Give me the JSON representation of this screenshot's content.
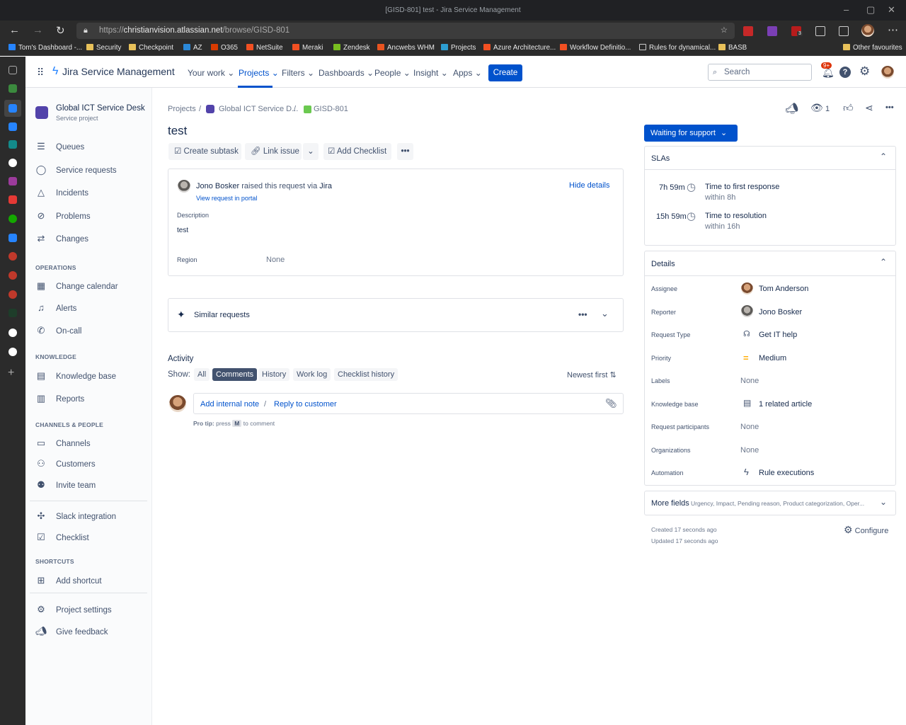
{
  "browser": {
    "window_title": "[GISD-801] test - Jira Service Management",
    "url_prefix": "https://",
    "url_host": "christianvision.atlassian.net",
    "url_path": "/browse/GISD-801",
    "bookmarks": [
      "Tom's Dashboard -...",
      "Security",
      "Checkpoint",
      "AZ",
      "O365",
      "NetSuite",
      "Meraki",
      "Zendesk",
      "Ancwebs WHM",
      "Projects",
      "Azure Architecture...",
      "Workflow Definitio...",
      "Rules for dynamical...",
      "BASB",
      "Other favourites"
    ],
    "notification_badge": "3"
  },
  "topnav": {
    "product": "Jira Service Management",
    "items": [
      "Your work",
      "Projects",
      "Filters",
      "Dashboards",
      "People",
      "Insight",
      "Apps"
    ],
    "create": "Create",
    "search_placeholder": "Search",
    "notifications": "9+"
  },
  "sidebar": {
    "project_name": "Global ICT Service Desk",
    "project_type": "Service project",
    "main": [
      "Queues",
      "Service requests",
      "Incidents",
      "Problems",
      "Changes"
    ],
    "operations_header": "OPERATIONS",
    "operations": [
      "Change calendar",
      "Alerts",
      "On-call"
    ],
    "knowledge_header": "KNOWLEDGE",
    "knowledge": [
      "Knowledge base",
      "Reports"
    ],
    "channels_header": "CHANNELS & PEOPLE",
    "channels": [
      "Channels",
      "Customers",
      "Invite team"
    ],
    "apps": [
      "Slack integration",
      "Checklist"
    ],
    "shortcuts_header": "SHORTCUTS",
    "shortcuts": [
      "Add shortcut"
    ],
    "footer": [
      "Project settings",
      "Give feedback"
    ]
  },
  "issue": {
    "breadcrumb": [
      "Projects",
      "Global ICT Service D...",
      "GISD-801"
    ],
    "title": "test",
    "toolbar": {
      "create_subtask": "Create subtask",
      "link_issue": "Link issue",
      "add_checklist": "Add Checklist"
    },
    "request": {
      "raiser": "Jono Bosker",
      "raised_text": "raised this request via",
      "via": "Jira",
      "view_portal": "View request in portal",
      "hide_details": "Hide details",
      "description_label": "Description",
      "description": "test",
      "region_label": "Region",
      "region_value": "None"
    },
    "similar_requests": "Similar requests",
    "activity": {
      "title": "Activity",
      "show_label": "Show:",
      "tabs": [
        "All",
        "Comments",
        "History",
        "Work log",
        "Checklist history"
      ],
      "active_tab": "Comments",
      "sort": "Newest first",
      "add_internal_note": "Add internal note",
      "separator": "/",
      "reply_to_customer": "Reply to customer",
      "protip_label": "Pro tip:",
      "protip_press": "press",
      "protip_key": "M",
      "protip_suffix": "to comment"
    },
    "watchers": "1",
    "status": "Waiting for support",
    "slas": {
      "title": "SLAs",
      "items": [
        {
          "time": "7h 59m",
          "name": "Time to first response",
          "within": "within 8h"
        },
        {
          "time": "15h 59m",
          "name": "Time to resolution",
          "within": "within 16h"
        }
      ]
    },
    "details": {
      "title": "Details",
      "rows": [
        {
          "label": "Assignee",
          "value": "Tom Anderson"
        },
        {
          "label": "Reporter",
          "value": "Jono Bosker"
        },
        {
          "label": "Request Type",
          "value": "Get IT help"
        },
        {
          "label": "Priority",
          "value": "Medium"
        },
        {
          "label": "Labels",
          "value": "None"
        },
        {
          "label": "Knowledge base",
          "value": "1 related article"
        },
        {
          "label": "Request participants",
          "value": "None"
        },
        {
          "label": "Organizations",
          "value": "None"
        },
        {
          "label": "Automation",
          "value": "Rule executions"
        }
      ]
    },
    "more_fields": {
      "title": "More fields",
      "summary": "Urgency, Impact, Pending reason, Product categorization, Oper..."
    },
    "created": "Created 17 seconds ago",
    "updated": "Updated 17 seconds ago",
    "configure": "Configure"
  },
  "colors": {
    "brand": "#0052cc",
    "status": "#0052cc",
    "priority_medium": "#ffab00"
  }
}
